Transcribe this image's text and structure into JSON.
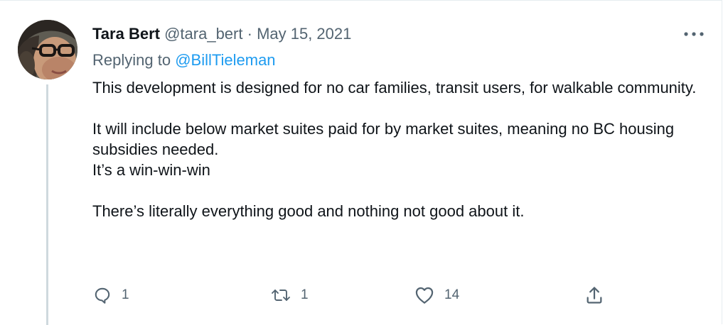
{
  "tweet": {
    "author_name": "Tara Bert",
    "author_handle": "@tara_bert",
    "separator": "·",
    "date": "May 15, 2021",
    "replying_prefix": "Replying to",
    "replying_to": "@BillTieleman",
    "paragraphs": [
      "This development is designed for no car families, transit users, for walkable community.",
      "",
      "It will include below market suites paid for by market suites, meaning no BC housing subsidies needed.",
      "It’s a win-win-win",
      "",
      "There’s literally everything good and nothing not good about it."
    ]
  },
  "actions": {
    "reply_count": "1",
    "retweet_count": "1",
    "like_count": "14"
  },
  "icons": {
    "more": "more-horizontal-icon",
    "reply": "reply-icon",
    "retweet": "retweet-icon",
    "like": "heart-icon",
    "share": "share-icon"
  },
  "colors": {
    "text": "#0f1419",
    "muted": "#536471",
    "link": "#1d9bf0",
    "thread_line": "#cfd9de"
  }
}
